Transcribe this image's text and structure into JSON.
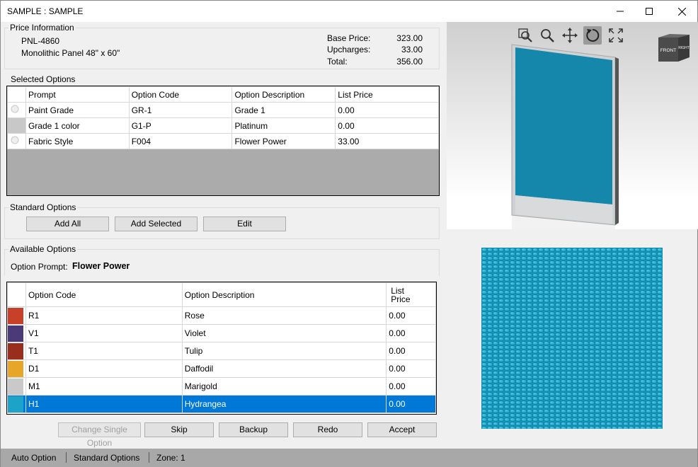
{
  "window": {
    "title": "SAMPLE : SAMPLE"
  },
  "price_info": {
    "group_label": "Price Information",
    "part_number": "PNL-4860",
    "description": "Monolithic Panel 48\" x 60\"",
    "base_price_label": "Base Price:",
    "base_price": "323.00",
    "upcharges_label": "Upcharges:",
    "upcharges": "33.00",
    "total_label": "Total:",
    "total": "356.00"
  },
  "selected_options": {
    "group_label": "Selected Options",
    "headers": [
      "Prompt",
      "Option Code",
      "Option Description",
      "List Price"
    ],
    "rows": [
      {
        "prompt": "Paint Grade",
        "code": "GR-1",
        "description": "Grade 1",
        "price": "0.00"
      },
      {
        "prompt": "Grade 1 color",
        "code": "G1-P",
        "description": "Platinum",
        "price": "0.00"
      },
      {
        "prompt": "Fabric Style",
        "code": "F004",
        "description": "Flower Power",
        "price": "33.00"
      }
    ]
  },
  "standard_options": {
    "group_label": "Standard Options",
    "add_all": "Add All",
    "add_selected": "Add Selected",
    "edit": "Edit"
  },
  "available_options": {
    "group_label": "Available Options",
    "prompt_label": "Option Prompt:",
    "prompt_value": "Flower Power",
    "headers": [
      "Option Code",
      "Option Description",
      "List\nPrice"
    ],
    "rows": [
      {
        "code": "R1",
        "description": "Rose",
        "price": "0.00",
        "color": "#c8402a"
      },
      {
        "code": "V1",
        "description": "Violet",
        "price": "0.00",
        "color": "#4a3a78"
      },
      {
        "code": "T1",
        "description": "Tulip",
        "price": "0.00",
        "color": "#9a2e1c"
      },
      {
        "code": "D1",
        "description": "Daffodil",
        "price": "0.00",
        "color": "#e7a52a"
      },
      {
        "code": "M1",
        "description": "Marigold",
        "price": "0.00",
        "color": "#c9c9c9"
      },
      {
        "code": "H1",
        "description": "Hydrangea",
        "price": "0.00",
        "color": "#1ea3c8"
      }
    ],
    "selected_index": 5
  },
  "actions": {
    "change_single": "Change Single Option",
    "skip": "Skip",
    "backup": "Backup",
    "redo": "Redo",
    "accept": "Accept"
  },
  "viewer": {
    "cube_front": "FRONT",
    "cube_right": "RIGHT",
    "panel_color": "#1487ab"
  },
  "status": {
    "mode": "Auto Option",
    "section": "Standard Options",
    "zone": "Zone: 1"
  }
}
